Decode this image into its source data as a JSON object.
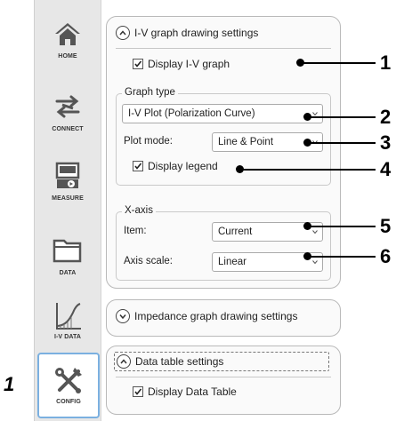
{
  "nav": {
    "items": [
      {
        "label": "HOME",
        "icon": "home-icon"
      },
      {
        "label": "CONNECT",
        "icon": "connect-icon"
      },
      {
        "label": "MEASURE",
        "icon": "measure-icon"
      },
      {
        "label": "DATA",
        "icon": "folder-icon"
      },
      {
        "label": "I-V DATA",
        "icon": "iv-chart-icon"
      },
      {
        "label": "CONFIG",
        "icon": "tools-icon"
      }
    ],
    "active": "CONFIG"
  },
  "left_callout": "1",
  "iv_settings": {
    "title": "I-V graph drawing settings",
    "display_iv_graph": {
      "label": "Display I-V graph",
      "checked": true
    },
    "graph_type": {
      "group_label": "Graph type",
      "selected": "I-V Plot (Polarization Curve)",
      "plot_mode_label": "Plot mode:",
      "plot_mode_value": "Line & Point",
      "display_legend": {
        "label": "Display legend",
        "checked": true
      }
    },
    "x_axis": {
      "group_label": "X-axis",
      "item_label": "Item:",
      "item_value": "Current",
      "scale_label": "Axis scale:",
      "scale_value": "Linear"
    }
  },
  "impedance_settings": {
    "title": "Impedance graph drawing settings"
  },
  "data_table_settings": {
    "title": "Data table settings",
    "display_data_table": {
      "label": "Display Data Table",
      "checked": true
    }
  },
  "callouts": [
    "1",
    "2",
    "3",
    "4",
    "5",
    "6"
  ],
  "colors": {
    "nav_bg": "#e7e7e7",
    "active_border": "#7bb0e0",
    "panel_border": "#b9b9b9"
  }
}
